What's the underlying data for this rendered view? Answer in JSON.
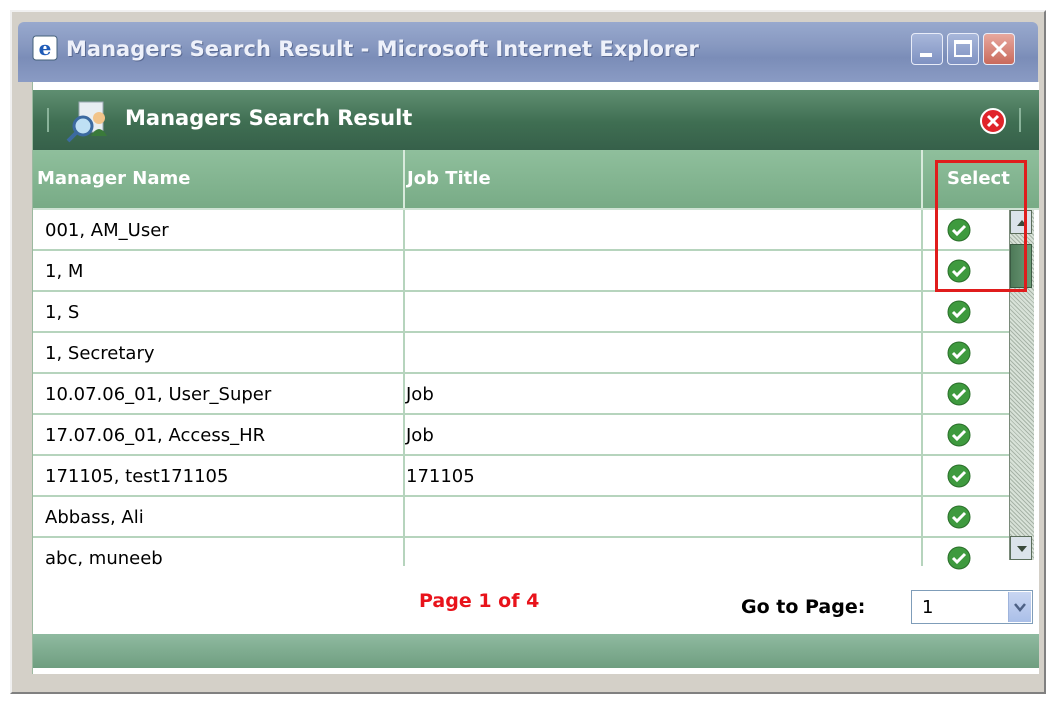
{
  "window": {
    "title": "Managers Search Result - Microsoft Internet Explorer"
  },
  "dialog": {
    "title": "Managers Search Result"
  },
  "table": {
    "columns": [
      "Manager Name",
      "Job Title",
      "Select"
    ],
    "rows": [
      {
        "name": "001, AM_User",
        "job": ""
      },
      {
        "name": "1, M",
        "job": ""
      },
      {
        "name": "1, S",
        "job": ""
      },
      {
        "name": "1, Secretary",
        "job": ""
      },
      {
        "name": "10.07.06_01, User_Super",
        "job": "Job"
      },
      {
        "name": "17.07.06_01, Access_HR",
        "job": "Job"
      },
      {
        "name": "171105, test171105",
        "job": "171105"
      },
      {
        "name": "Abbass, Ali",
        "job": ""
      },
      {
        "name": "abc, muneeb",
        "job": ""
      }
    ]
  },
  "pager": {
    "status": "Page 1 of 4",
    "goto_label": "Go to Page:",
    "goto_value": "1"
  },
  "colors": {
    "header_green": "#3f6e52",
    "column_header_green": "#8fbf9c",
    "pager_red": "#e8131b",
    "highlight_red": "#e01c1c"
  }
}
